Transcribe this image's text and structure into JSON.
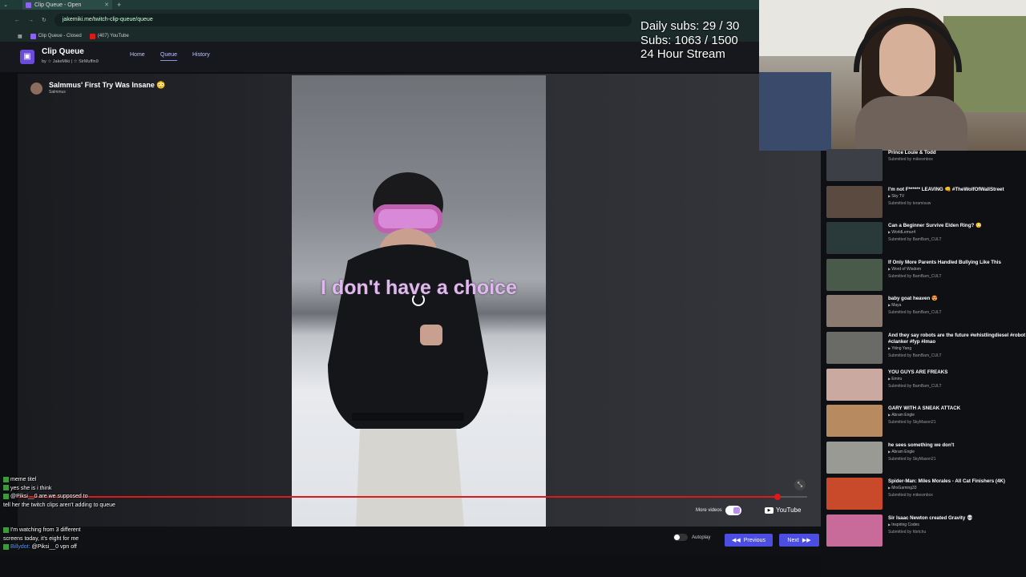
{
  "browser": {
    "tab_title": "Clip Queue - Open",
    "url": "jakemiki.me/twitch-clip-queue/queue",
    "bookmarks": [
      {
        "label": "Clip Queue - Closed",
        "icon": "clip-queue-icon",
        "color": "#8e62f0"
      },
      {
        "label": "(407) YouTube",
        "icon": "youtube-icon",
        "color": "#e01818"
      }
    ]
  },
  "stats": {
    "daily_subs": "Daily subs: 29 / 30",
    "subs": "Subs: 1063 / 1500",
    "stream": "24 Hour Stream"
  },
  "app": {
    "title": "Clip Queue",
    "subtitle": "by ☆ JakeMiki | ☆ SirMuffin9",
    "nav": [
      "Home",
      "Queue",
      "History"
    ],
    "active_nav": "Queue"
  },
  "clip": {
    "title": "Salmmus' First Try Was Insane 😳",
    "author": "Salmmus",
    "subtitle_text": "I don't have a choice",
    "progress": 0.963
  },
  "player": {
    "more_videos": "More videos",
    "youtube": "YouTube",
    "autoplay": "Autoplay",
    "previous": "Previous",
    "next": "Next"
  },
  "chat": [
    {
      "user": "",
      "text": "meme titel"
    },
    {
      "user": "",
      "text": "yes she is i think"
    },
    {
      "user": "",
      "text": "@Piksi__0 are we supposed to"
    },
    {
      "user": "",
      "text": "tell her the twitch clips aren't adding to queue"
    },
    {
      "user": "",
      "text": "I'm watching from 3 different"
    },
    {
      "user": "",
      "text": "screens today, it's eight for me"
    },
    {
      "user": "Billydot:",
      "text": "@Piksi__0 vpn off"
    }
  ],
  "queue": [
    {
      "title": "Prince Louie & Todd",
      "channel": "",
      "submitted": "Submitted by mikesmbox",
      "thumb": "#3c3f46"
    },
    {
      "title": "I'm not F****** LEAVING 👊 #TheWolfOfWallStreet",
      "channel": "Sky TV",
      "submitted": "Submitted by teramisuw",
      "thumb": "#5a4a40"
    },
    {
      "title": "Can a Beginner Survive Elden Ring? 😳",
      "channel": "WorldLemur4",
      "submitted": "Submitted by BamBam_CULT",
      "thumb": "#2a3a3a"
    },
    {
      "title": "If Only More Parents Handled Bullying Like This",
      "channel": "Word of Wisdom",
      "submitted": "Submitted by BamBam_CULT",
      "thumb": "#4a5a4a"
    },
    {
      "title": "baby goat heaven 😍",
      "channel": "Maya",
      "submitted": "Submitted by BamBam_CULT",
      "thumb": "#8a7a70"
    },
    {
      "title": "And they say robots are the future #whistlingdiesel #robot #clanker #fyp #lmao",
      "channel": "Yiting Yang",
      "submitted": "Submitted by BamBam_CULT",
      "thumb": "#6a6a66"
    },
    {
      "title": "YOU GUYS ARE FREAKS",
      "channel": "Emiru",
      "submitted": "Submitted by BamBam_CULT",
      "thumb": "#c9a9a0"
    },
    {
      "title": "GARY WITH A SNEAK ATTACK",
      "channel": "Abram Engle",
      "submitted": "Submitted by SkyMason21",
      "thumb": "#b88a60"
    },
    {
      "title": "he sees something we don't",
      "channel": "Abram Engle",
      "submitted": "Submitted by SkyMason21",
      "thumb": "#9a9a94"
    },
    {
      "title": "Spider-Man: Miles Morales - All Cat Finishers (4K)",
      "channel": "MrsGaming33",
      "submitted": "Submitted by mikesmbox",
      "thumb": "#c84a2a"
    },
    {
      "title": "Sir Isaac Newton created Gravity 💀",
      "channel": "Inspiring Codes",
      "submitted": "Submitted by hbrtchu",
      "thumb": "#c86a9a"
    }
  ]
}
